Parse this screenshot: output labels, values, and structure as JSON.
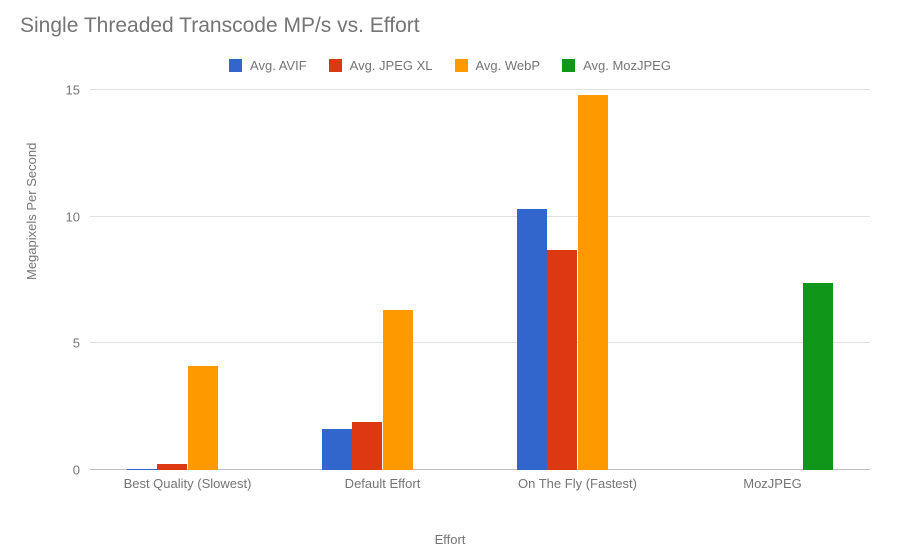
{
  "title": "Single Threaded Transcode MP/s vs. Effort",
  "ylabel": "Megapixels Per Second",
  "xlabel": "Effort",
  "legend": {
    "avif": {
      "label": "Avg. AVIF",
      "color": "#3366cc"
    },
    "jpegxl": {
      "label": "Avg. JPEG XL",
      "color": "#dc3912"
    },
    "webp": {
      "label": "Avg. WebP",
      "color": "#ff9900"
    },
    "mozjpeg": {
      "label": "Avg. MozJPEG",
      "color": "#109618"
    }
  },
  "yticks": [
    "0",
    "5",
    "10",
    "15"
  ],
  "chart_data": {
    "type": "bar",
    "title": "Single Threaded Transcode MP/s vs. Effort",
    "xlabel": "Effort",
    "ylabel": "Megapixels Per Second",
    "ylim": [
      0,
      15
    ],
    "categories": [
      "Best Quality (Slowest)",
      "Default Effort",
      "On The Fly (Fastest)",
      "MozJPEG"
    ],
    "series": [
      {
        "name": "Avg. AVIF",
        "color": "#3366cc",
        "values": [
          0.05,
          1.6,
          10.3,
          0.0
        ]
      },
      {
        "name": "Avg. JPEG XL",
        "color": "#dc3912",
        "values": [
          0.25,
          1.9,
          8.7,
          0.0
        ]
      },
      {
        "name": "Avg. WebP",
        "color": "#ff9900",
        "values": [
          4.1,
          6.3,
          14.8,
          0.0
        ]
      },
      {
        "name": "Avg. MozJPEG",
        "color": "#109618",
        "values": [
          0.0,
          0.0,
          0.0,
          7.4
        ]
      }
    ],
    "legend_position": "top",
    "grid": true
  }
}
